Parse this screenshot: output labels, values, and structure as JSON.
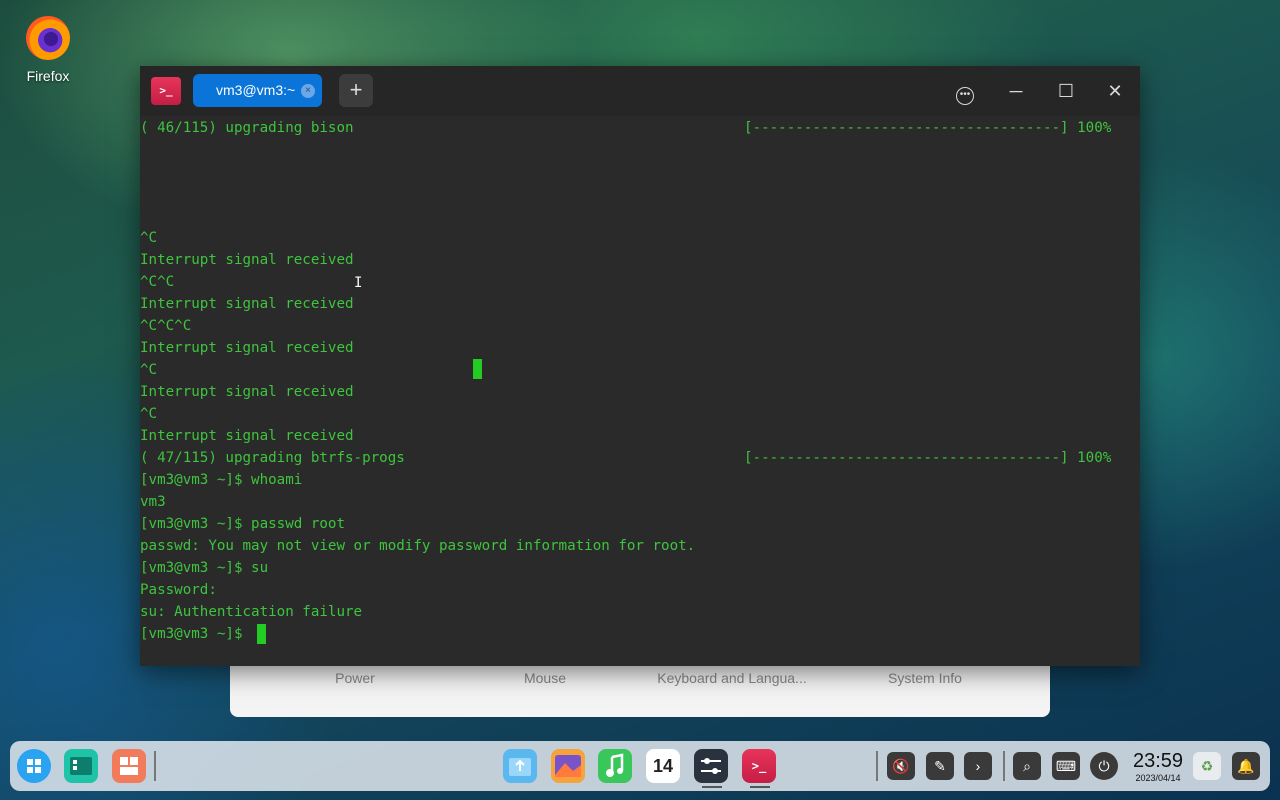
{
  "desktop": {
    "icons": [
      {
        "label": "Firefox",
        "icon": "firefox-icon"
      }
    ]
  },
  "settings_panel": {
    "items": [
      "Power",
      "Mouse",
      "Keyboard and Langua...",
      "System Info"
    ]
  },
  "terminal": {
    "tab_title": "vm3@vm3:~",
    "new_tab_symbol": "+",
    "close_symbol": "×",
    "lines": [
      "( 46/115) upgrading bison",
      "",
      "",
      "",
      "",
      "^C",
      "Interrupt signal received",
      "^C^C",
      "Interrupt signal received",
      "^C^C^C",
      "Interrupt signal received",
      "^C",
      "Interrupt signal received",
      "^C",
      "Interrupt signal received",
      "( 47/115) upgrading btrfs-progs",
      "[vm3@vm3 ~]$ whoami",
      "vm3",
      "[vm3@vm3 ~]$ passwd root",
      "passwd: You may not view or modify password information for root.",
      "[vm3@vm3 ~]$ su",
      "Password:",
      "su: Authentication failure",
      "[vm3@vm3 ~]$ "
    ],
    "progress_lines": [
      {
        "line_index": 0,
        "text": "[------------------------------------] 100%",
        "percent": 100
      },
      {
        "line_index": 15,
        "text": "[------------------------------------] 100%",
        "percent": 100
      }
    ],
    "colors": {
      "text": "#3ec43e",
      "background": "#2a2a2a",
      "accent_tab": "#0a74d8"
    }
  },
  "taskbar": {
    "apps": [
      "launcher-icon",
      "multitasking-icon",
      "workspace-icon",
      "file-manager-icon",
      "image-viewer-icon",
      "music-icon",
      "calendar-icon",
      "control-center-icon",
      "terminal-icon"
    ],
    "calendar_day": "14",
    "clock": {
      "time": "23:59",
      "date": "2023/04/14"
    },
    "tray": [
      "volume-muted-icon",
      "pen-icon",
      "chevron-right-icon",
      "search-icon",
      "keyboard-icon",
      "power-icon",
      "trash-icon",
      "notification-icon"
    ]
  }
}
